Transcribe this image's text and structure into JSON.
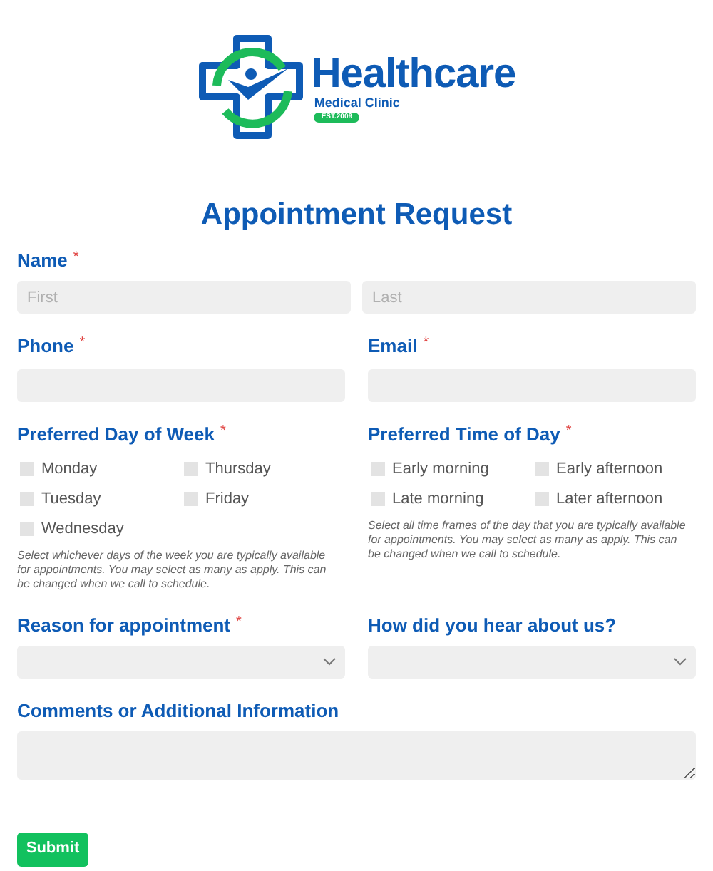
{
  "logo": {
    "name": "Healthcare",
    "subtitle": "Medical Clinic",
    "badge": "EST.2009"
  },
  "title": "Appointment Request",
  "name_field": {
    "label": "Name",
    "required_mark": "*",
    "first_placeholder": "First",
    "last_placeholder": "Last"
  },
  "contact_fields": [
    {
      "label": "Phone",
      "required_mark": "*"
    },
    {
      "label": "Email",
      "required_mark": "*"
    }
  ],
  "checkbox_groups": [
    {
      "label": "Preferred Day of Week",
      "required_mark": "*",
      "options": [
        {
          "label": "Monday",
          "checked": false
        },
        {
          "label": "Tuesday",
          "checked": false
        },
        {
          "label": "Wednesday",
          "checked": false
        },
        {
          "label": "Thursday",
          "checked": false
        },
        {
          "label": "Friday",
          "checked": false
        }
      ],
      "help": "Select whichever days of the week you are typically available for appointments. You may select as many as apply. This can be changed when we call to schedule."
    },
    {
      "label": "Preferred Time of Day",
      "required_mark": "*",
      "options": [
        {
          "label": "Early morning",
          "checked": false
        },
        {
          "label": "Late morning",
          "checked": false
        },
        {
          "label": "Early afternoon",
          "checked": false
        },
        {
          "label": "Later afternoon",
          "checked": false
        }
      ],
      "help": "Select all time frames of the day that you are typically available for appointments. You may select as many as apply. This can be changed when we call to schedule."
    }
  ],
  "select_fields": [
    {
      "label": "Reason for appointment",
      "required_mark": "*"
    },
    {
      "label": "How did you hear about us?"
    }
  ],
  "comments": {
    "label": "Comments or Additional Information"
  },
  "submit": "Submit"
}
